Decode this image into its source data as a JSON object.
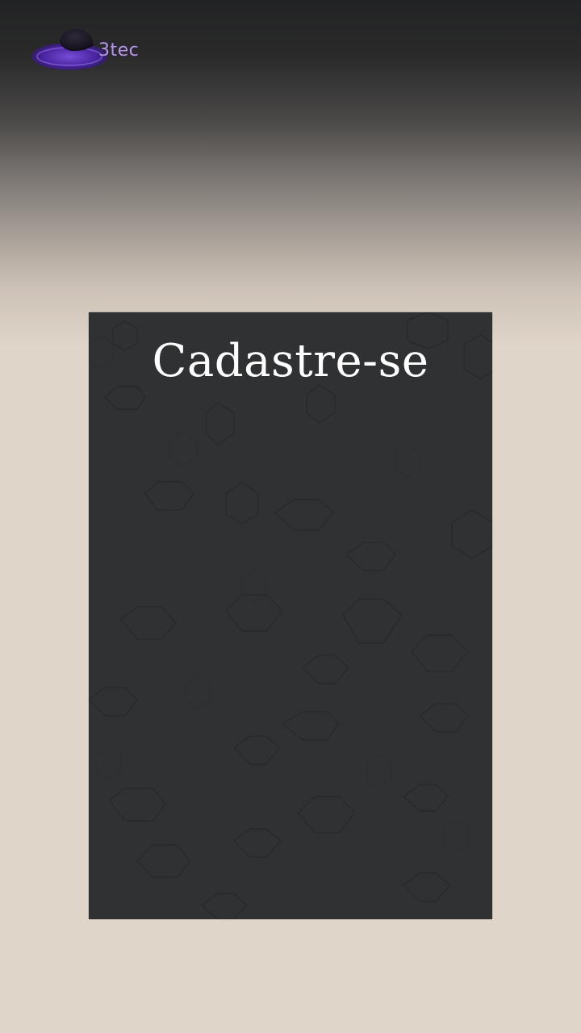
{
  "brand": {
    "logo_text": "3tec"
  },
  "signup_panel": {
    "title": "Cadastre-se"
  },
  "colors": {
    "panel_background": "#303133",
    "page_background": "#e0d5c9",
    "top_gradient": "#222324",
    "logo_purple": "#5b2fc0"
  }
}
